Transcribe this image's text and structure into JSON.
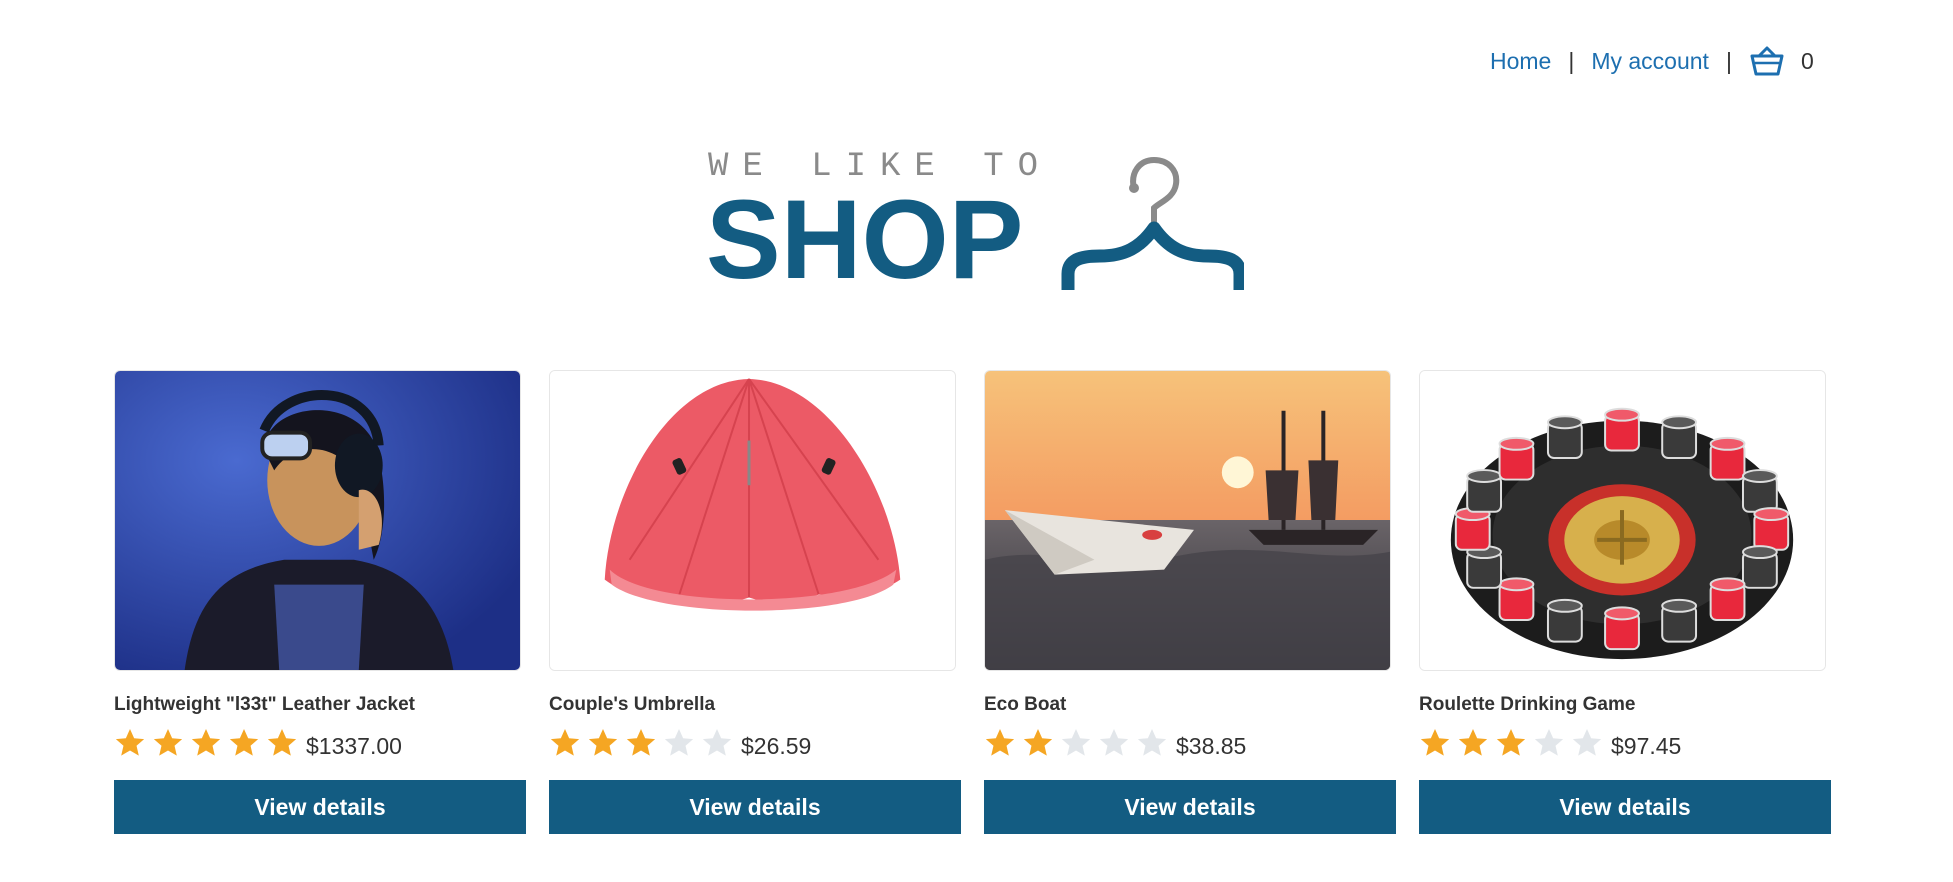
{
  "nav": {
    "home": "Home",
    "separator": "|",
    "account": "My account",
    "cart_icon": "basket-icon",
    "cart_count": "0"
  },
  "logo": {
    "tagline": "WE LIKE TO",
    "main": "SHOP",
    "icon": "hanger-icon"
  },
  "products": [
    {
      "name": "Lightweight \"l33t\" Leather Jacket",
      "rating": 5,
      "price": "$1337.00",
      "button": "View details"
    },
    {
      "name": "Couple's Umbrella",
      "rating": 3,
      "price": "$26.59",
      "button": "View details"
    },
    {
      "name": "Eco Boat",
      "rating": 2,
      "price": "$38.85",
      "button": "View details"
    },
    {
      "name": "Roulette Drinking Game",
      "rating": 3,
      "price": "$97.45",
      "button": "View details"
    }
  ],
  "colors": {
    "brand": "#135c82",
    "link": "#1d6fb0",
    "star_on": "#f5a623",
    "star_off": "#e2e6ea"
  }
}
